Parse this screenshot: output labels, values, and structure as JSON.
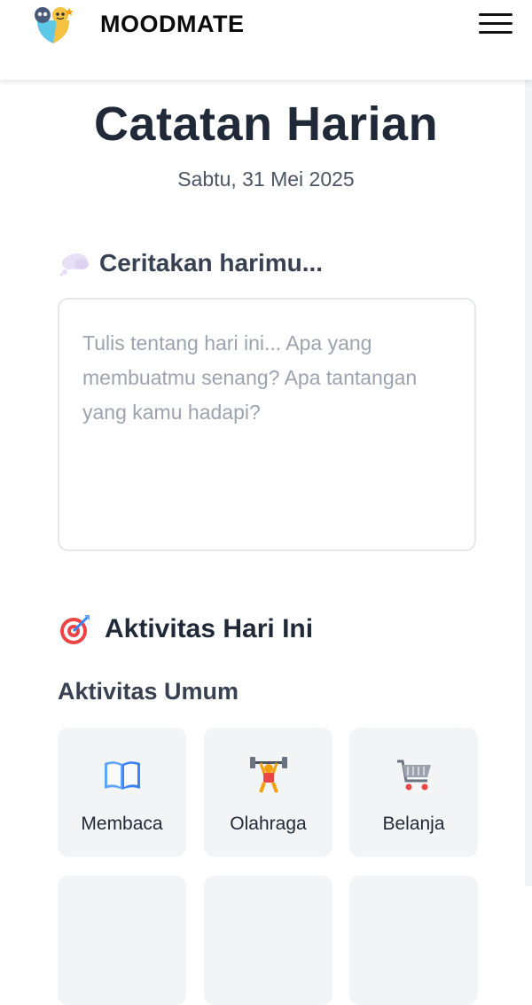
{
  "header": {
    "brand": "MOODMATE",
    "logo_icon": "mood-faces-logo",
    "menu_icon": "hamburger-menu-icon"
  },
  "page": {
    "title": "Catatan Harian",
    "date": "Sabtu, 31 Mei 2025"
  },
  "story": {
    "heading": "Ceritakan harimu...",
    "icon": "thought-bubble-icon",
    "placeholder": "Tulis tentang hari ini... Apa yang membuatmu senang? Apa tantangan yang kamu hadapi?",
    "value": ""
  },
  "activities": {
    "heading": "Aktivitas Hari Ini",
    "icon": "target-icon",
    "category": "Aktivitas Umum",
    "items": [
      {
        "label": "Membaca",
        "icon": "open-book-icon"
      },
      {
        "label": "Olahraga",
        "icon": "weightlifter-icon"
      },
      {
        "label": "Belanja",
        "icon": "shopping-cart-icon"
      }
    ]
  },
  "colors": {
    "title": "#1f2937",
    "card_bg": "#f3f4f6",
    "input_border": "#e5e7eb",
    "placeholder": "#9ca3af"
  }
}
